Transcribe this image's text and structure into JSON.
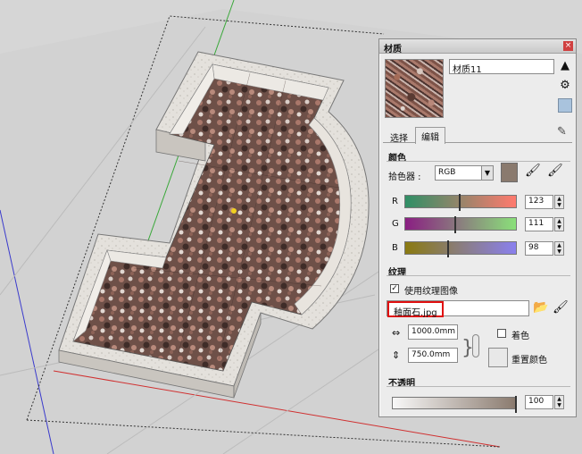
{
  "panel": {
    "title": "材质",
    "material_name": "材质11",
    "tabs": [
      "选择",
      "编辑"
    ],
    "active_tab": "编辑",
    "color_section": "颜色",
    "picker_label": "拾色器 :",
    "picker_mode": "RGB",
    "swatch_color": "#8a7a6e",
    "channels": [
      {
        "label": "R",
        "value": "123",
        "level": 0.48,
        "from": "#2f8f66",
        "to": "#ff7a6e"
      },
      {
        "label": "G",
        "value": "111",
        "level": 0.44,
        "from": "#8a1e82",
        "to": "#8ae07a"
      },
      {
        "label": "B",
        "value": "98",
        "level": 0.38,
        "from": "#8a7a10",
        "to": "#8a80ee"
      }
    ],
    "texture_section": "纹理",
    "use_texture_label": "使用纹理图像",
    "texture_file": "釉面石.jpg",
    "width_value": "1000.0mm",
    "height_value": "750.0mm",
    "colorize_label": "着色",
    "reset_color_label": "重置颜色",
    "opacity_section": "不透明",
    "opacity_value": "100"
  },
  "icons": {
    "close": "close-icon",
    "paint": "paint-bucket-icon",
    "eyedropper": "eyedropper-icon"
  }
}
